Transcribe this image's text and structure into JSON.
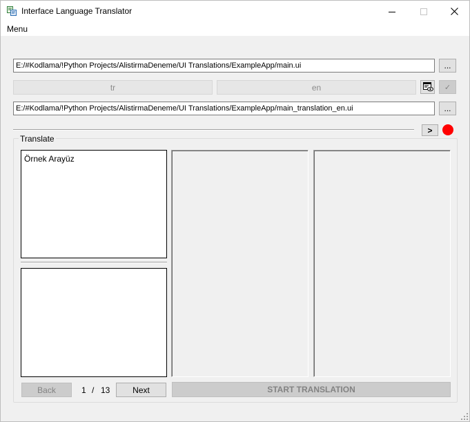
{
  "window": {
    "title": "Interface Language Translator"
  },
  "menu": {
    "label": "Menu"
  },
  "source": {
    "path": "E:/#Kodlama/!Python Projects/AlistirmaDeneme/UI Translations/ExampleApp/main.ui",
    "browse_label": "..."
  },
  "languages": {
    "from": "tr",
    "to": "en",
    "confirm_glyph": "✓"
  },
  "output": {
    "path": "E:/#Kodlama/!Python Projects/AlistirmaDeneme/UI Translations/ExampleApp/main_translation_en.ui",
    "browse_label": "..."
  },
  "run_button_label": ">",
  "status_color": "#ff0000",
  "translate": {
    "group_title": "Translate",
    "source_text": "Örnek Arayüz",
    "back_label": "Back",
    "next_label": "Next",
    "page_current": "1",
    "page_separator": "/",
    "page_total": "13",
    "start_label": "START TRANSLATION"
  }
}
